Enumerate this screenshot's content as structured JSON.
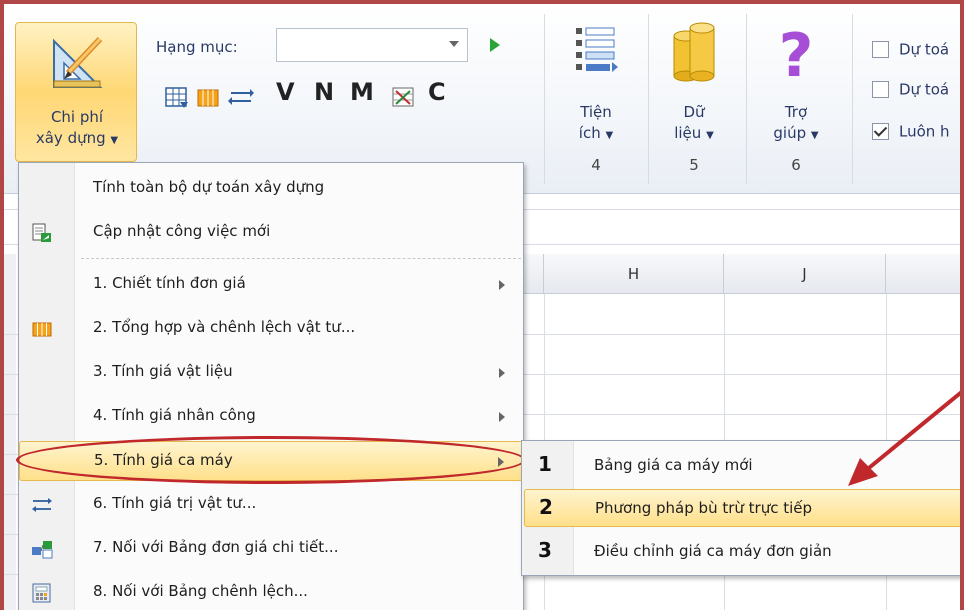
{
  "ribbon": {
    "chiphi_label_1": "Chi phí",
    "chiphi_label_2": "xây dựng",
    "hangmuc_label": "Hạng mục:",
    "hangmuc_value": "",
    "letters": [
      "V",
      "N",
      "M",
      "C"
    ],
    "tienich": {
      "l1": "Tiện",
      "l2": "ích",
      "num": "4"
    },
    "dulieu": {
      "l1": "Dữ",
      "l2": "liệu",
      "num": "5"
    },
    "trogiup": {
      "l1": "Trợ",
      "l2": "giúp",
      "num": "6"
    },
    "checks": [
      {
        "label": "Dự toá",
        "checked": false
      },
      {
        "label": "Dự toá",
        "checked": false
      },
      {
        "label": "Luôn h",
        "checked": true
      }
    ]
  },
  "grid": {
    "columns": [
      "H",
      "J"
    ]
  },
  "menu": {
    "items": [
      {
        "label": "Tính toàn bộ dự toán xây dựng",
        "icon": "none",
        "submenu": false
      },
      {
        "label": "Cập nhật công việc mới",
        "icon": "document-update-icon",
        "submenu": false
      },
      {
        "label": "1. Chiết tính đơn giá",
        "icon": "none",
        "submenu": true
      },
      {
        "label": "2. Tổng hợp và chênh lệch vật tư...",
        "icon": "columns-icon",
        "submenu": false
      },
      {
        "label": "3. Tính giá vật liệu",
        "icon": "none",
        "submenu": true
      },
      {
        "label": "4. Tính giá nhân công",
        "icon": "none",
        "submenu": true
      },
      {
        "label": "5. Tính giá ca máy",
        "icon": "none",
        "submenu": true
      },
      {
        "label": "6. Tính giá trị vật tư...",
        "icon": "transfer-arrows-icon",
        "submenu": false
      },
      {
        "label": "7. Nối với Bảng đơn giá chi tiết...",
        "icon": "link-table-icon",
        "submenu": false
      },
      {
        "label": "8. Nối với Bảng chênh lệch...",
        "icon": "calculator-icon",
        "submenu": false
      }
    ]
  },
  "submenu": {
    "items": [
      {
        "num": "1",
        "label": "Bảng giá ca máy mới"
      },
      {
        "num": "2",
        "label": "Phương pháp bù trừ trực tiếp"
      },
      {
        "num": "3",
        "label": "Điều chỉnh giá ca máy đơn giản"
      }
    ]
  },
  "colors": {
    "highlight": "#ffe08a",
    "annotation": "#c0282c",
    "frame": "#b04646"
  }
}
